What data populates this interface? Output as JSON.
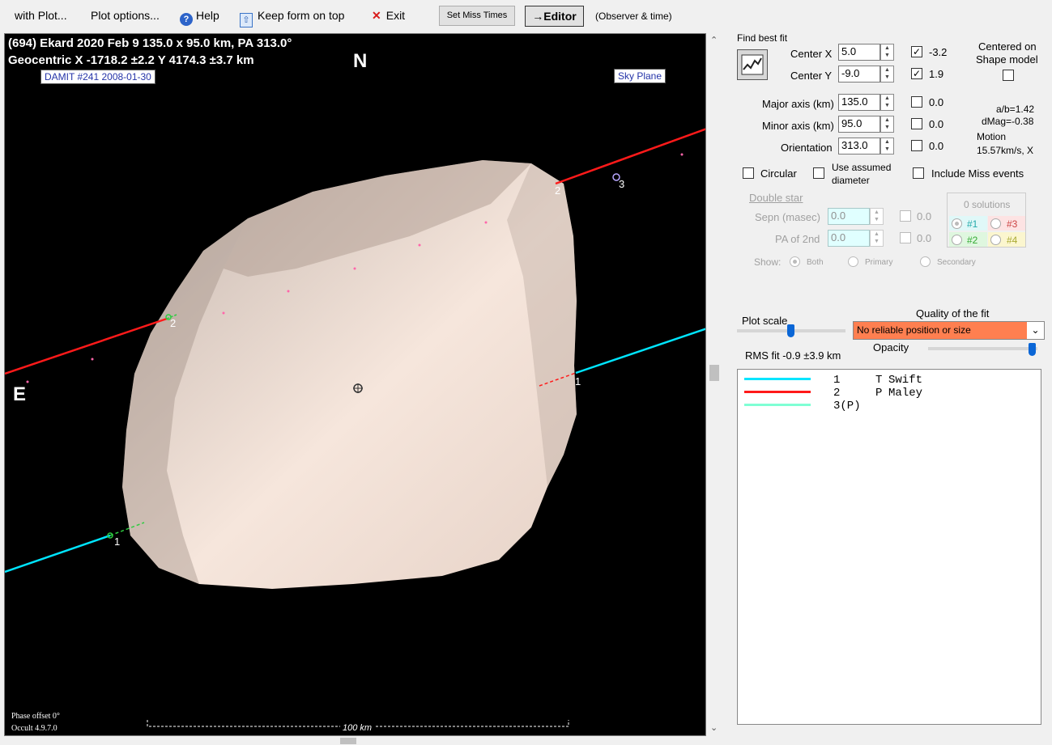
{
  "menu": {
    "with_plot": "with Plot...",
    "plot_options": "Plot options...",
    "help": "Help",
    "keep_on_top": "Keep form on top",
    "exit": "Exit",
    "set_miss_times": "Set Miss Times",
    "editor": "→Editor",
    "observer_time": "(Observer & time)"
  },
  "plot": {
    "title_line1": "(694) Ekard  2020 Feb 9   135.0 x 95.0 km, PA 313.0°",
    "title_line2": "Geocentric  X  -1718.2 ±2.2  Y 4174.3 ±3.7 km",
    "damit_label": "DAMIT #241 2008-01-30",
    "sky_plane": "Sky Plane",
    "north": "N",
    "east": "E",
    "phase_offset": "Phase offset 0°",
    "version": "Occult 4.9.7.0",
    "scale_label": "100 km",
    "chord_labels": [
      "1",
      "2",
      "1",
      "2",
      "3"
    ]
  },
  "fit": {
    "find_best_fit": "Find best fit",
    "center_x_label": "Center X",
    "center_x_value": "5.0",
    "center_x_check": "-3.2",
    "center_y_label": "Center Y",
    "center_y_value": "-9.0",
    "center_y_check": "1.9",
    "centered_on": "Centered on",
    "shape_model": "Shape model",
    "major_label": "Major axis (km)",
    "major_value": "135.0",
    "major_check": "0.0",
    "minor_label": "Minor axis (km)",
    "minor_value": "95.0",
    "minor_check": "0.0",
    "orient_label": "Orientation",
    "orient_value": "313.0",
    "orient_check": "0.0",
    "ab_ratio": "a/b=1.42",
    "dmag": "dMag=-0.38",
    "motion": "Motion",
    "motion_value": "15.57km/s, X",
    "circular": "Circular",
    "use_assumed": "Use assumed",
    "diameter": "diameter",
    "include_miss": "Include Miss events"
  },
  "double_star": {
    "title": "Double star",
    "sepn_label": "Sepn (masec)",
    "sepn_value": "0.0",
    "sepn_check": "0.0",
    "pa_label": "PA of 2nd",
    "pa_value": "0.0",
    "pa_check": "0.0",
    "show_label": "Show:",
    "both": "Both",
    "primary": "Primary",
    "secondary": "Secondary",
    "solutions": "0 solutions",
    "sol1": "#1",
    "sol2": "#2",
    "sol3": "#3",
    "sol4": "#4"
  },
  "scale": {
    "plot_scale": "Plot scale",
    "quality_label": "Quality of the fit",
    "quality_value": "No reliable position or size",
    "rms_fit": "RMS fit  -0.9 ±3.9 km",
    "opacity": "Opacity"
  },
  "legend": [
    {
      "num": "1",
      "code": "T",
      "name": "Swift",
      "color": "#00e5ff"
    },
    {
      "num": "2",
      "code": "P",
      "name": "Maley",
      "color": "#ff1a1a"
    },
    {
      "num": "3(P)",
      "code": "",
      "name": "",
      "color": "#7fffd4"
    }
  ],
  "colors": {
    "shape": "#f0ddd3",
    "chord1": "#00e5ff",
    "chord2": "#ff1a1a",
    "quality_bg": "#ff7f50"
  }
}
